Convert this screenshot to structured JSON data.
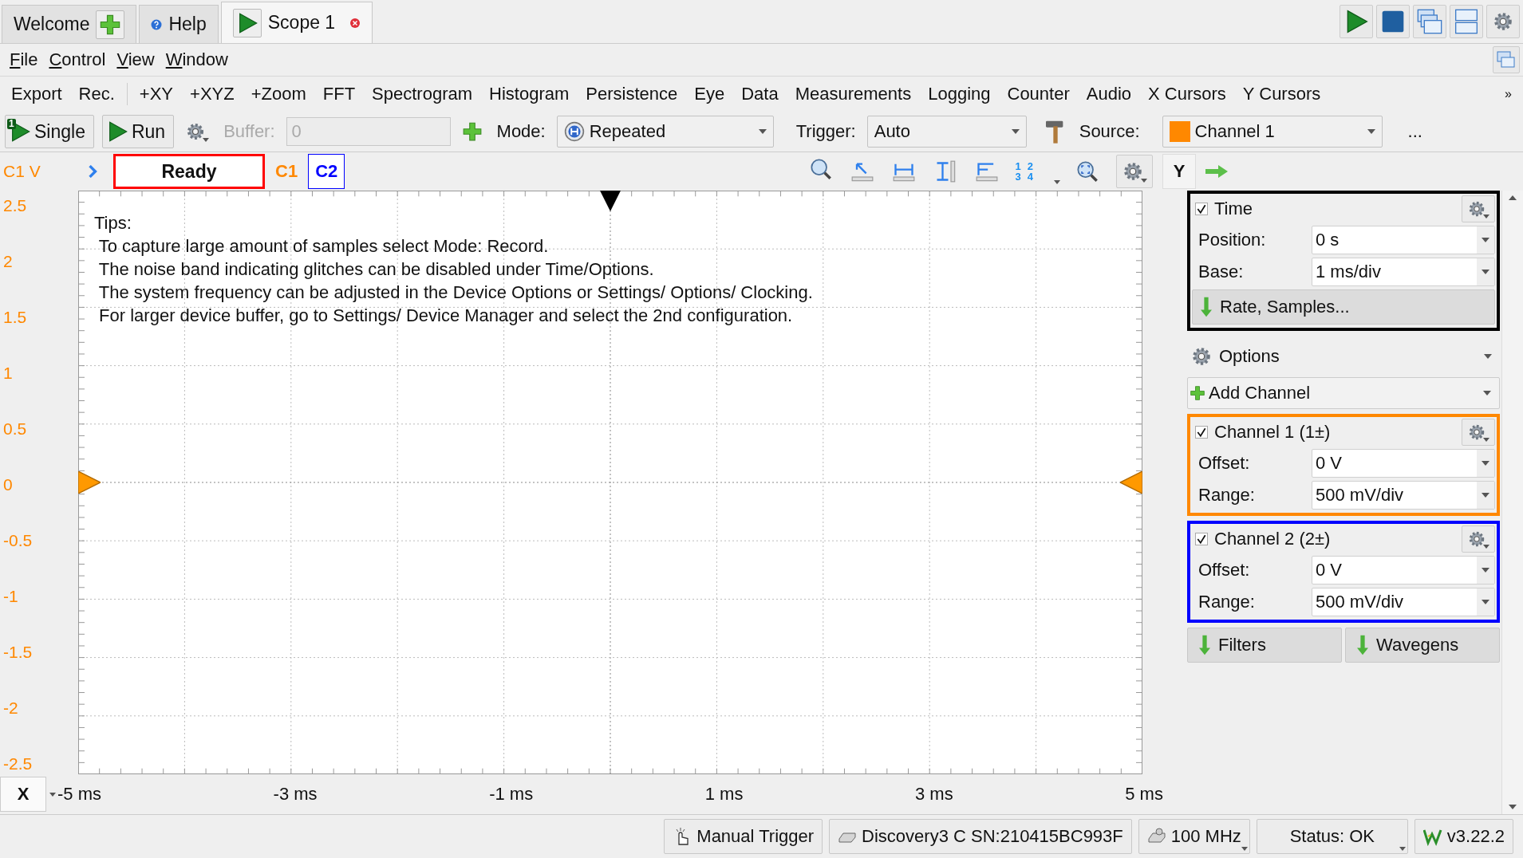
{
  "tabs": [
    {
      "label": "Welcome",
      "kind": "add",
      "selected": false
    },
    {
      "label": "Help",
      "kind": "help",
      "selected": false
    },
    {
      "label": "Scope 1",
      "kind": "scope",
      "selected": true
    }
  ],
  "menu": [
    "File",
    "Control",
    "View",
    "Window"
  ],
  "toolbar": [
    "Export",
    "Rec.",
    "+XY",
    "+XYZ",
    "+Zoom",
    "FFT",
    "Spectrogram",
    "Histogram",
    "Persistence",
    "Eye",
    "Data",
    "Measurements",
    "Logging",
    "Counter",
    "Audio",
    "X Cursors",
    "Y Cursors"
  ],
  "toolbar_overflow": "»",
  "controls": {
    "single": "Single",
    "single_badge": "1",
    "run": "Run",
    "buffer": {
      "label": "Buffer:",
      "value": "0",
      "disabled": true
    },
    "mode": {
      "label": "Mode:",
      "value": "Repeated"
    },
    "trigger": {
      "label": "Trigger:",
      "value": "Auto"
    },
    "source": {
      "label": "Source:",
      "value": "Channel 1",
      "color": "#ff8800"
    },
    "more": "..."
  },
  "scope": {
    "y_unit": "C1 V",
    "status": "Ready",
    "channels": [
      {
        "label": "C1",
        "color": "#ff8800",
        "selected": false
      },
      {
        "label": "C2",
        "color": "#0000ff",
        "selected": true
      }
    ],
    "cursor_numbers": [
      "1",
      "2",
      "3",
      "4"
    ],
    "y_button": "Y",
    "x_button": "X"
  },
  "plot": {
    "tips": [
      "Tips:",
      " To capture large amount of samples select Mode: Record.",
      " The noise band indicating glitches can be disabled under Time/Options.",
      " The system frequency can be adjusted in the Device Options or Settings/ Options/ Clocking.",
      " For larger device buffer, go to Settings/ Device Manager and select the 2nd configuration."
    ],
    "y_labels": [
      "2.5",
      "2",
      "1.5",
      "1",
      "0.5",
      "0",
      "-0.5",
      "-1",
      "-1.5",
      "-2",
      "-2.5"
    ],
    "x_labels": [
      "-5 ms",
      "-3 ms",
      "-1 ms",
      "1 ms",
      "3 ms",
      "5 ms"
    ]
  },
  "panel": {
    "time": {
      "title": "Time",
      "checked": true,
      "fields": [
        {
          "label": "Position:",
          "value": "0 s"
        },
        {
          "label": "Base:",
          "value": "1 ms/div"
        }
      ],
      "button": "Rate, Samples..."
    },
    "options": "Options",
    "add_channel": "Add Channel",
    "channels": [
      {
        "title": "Channel 1 (1±)",
        "checked": true,
        "color": "#ff8800",
        "fields": [
          {
            "label": "Offset:",
            "value": "0 V"
          },
          {
            "label": "Range:",
            "value": "500 mV/div"
          }
        ]
      },
      {
        "title": "Channel 2 (2±)",
        "checked": true,
        "color": "#0000ff",
        "fields": [
          {
            "label": "Offset:",
            "value": "0 V"
          },
          {
            "label": "Range:",
            "value": "500 mV/div"
          }
        ]
      }
    ],
    "buttons": [
      "Filters",
      "Wavegens"
    ]
  },
  "status_bar": [
    {
      "kind": "trigger",
      "text": "Manual Trigger"
    },
    {
      "kind": "device",
      "text": "Discovery3 C SN:210415BC993F"
    },
    {
      "kind": "clock",
      "text": "100 MHz"
    },
    {
      "kind": "status",
      "text": "Status: OK"
    },
    {
      "kind": "version",
      "text": "v3.22.2"
    }
  ]
}
